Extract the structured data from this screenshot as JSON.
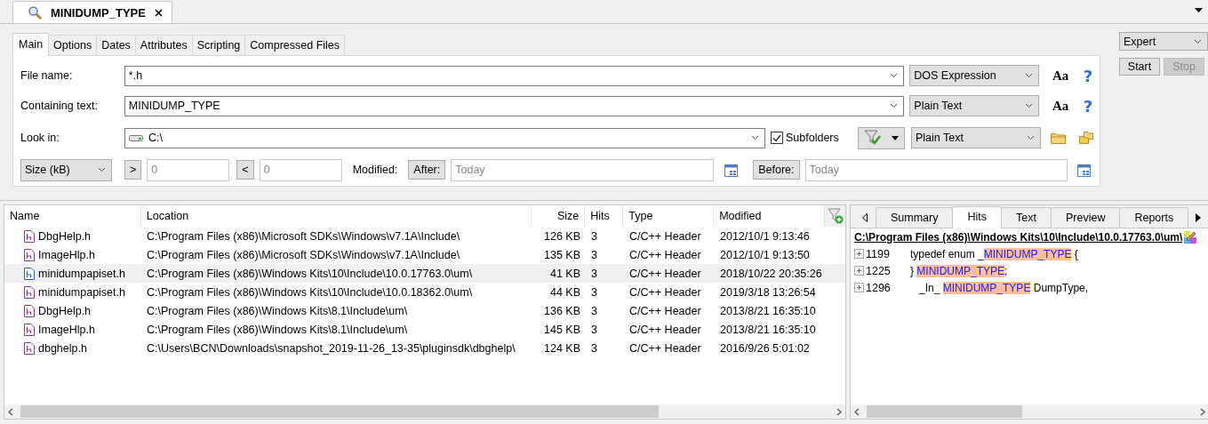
{
  "document_tab": {
    "title": "MINIDUMP_TYPE"
  },
  "search_tabs": [
    {
      "label": "Main",
      "selected": true
    },
    {
      "label": "Options",
      "selected": false
    },
    {
      "label": "Dates",
      "selected": false
    },
    {
      "label": "Attributes",
      "selected": false
    },
    {
      "label": "Scripting",
      "selected": false
    },
    {
      "label": "Compressed Files",
      "selected": false
    }
  ],
  "form": {
    "file_name": {
      "label": "File name:",
      "value": "*.h",
      "mode": "DOS Expression",
      "case_button": "Aa",
      "help_button": "?"
    },
    "containing_text": {
      "label": "Containing text:",
      "value": "MINIDUMP_TYPE",
      "mode": "Plain Text",
      "case_button": "Aa",
      "help_button": "?"
    },
    "look_in": {
      "label": "Look in:",
      "value": "C:\\",
      "subfolders_label": "Subfolders",
      "subfolders_checked": true,
      "mode": "Plain Text"
    },
    "size": {
      "unit": "Size (kB)",
      "greater_button": ">",
      "greater_value": "0",
      "less_button": "<",
      "less_value": "0"
    },
    "modified": {
      "label": "Modified:",
      "after_button": "After:",
      "after_placeholder": "Today",
      "before_button": "Before:",
      "before_placeholder": "Today"
    }
  },
  "search_mode": "Expert",
  "buttons": [
    {
      "label": "Start",
      "disabled": false
    },
    {
      "label": "Stop",
      "disabled": true
    }
  ],
  "results": {
    "columns": [
      "Name",
      "Location",
      "Size",
      "Hits",
      "Type",
      "Modified"
    ],
    "rows": [
      {
        "name": "DbgHelp.h",
        "location": "C:\\Program Files (x86)\\Microsoft SDKs\\Windows\\v7.1A\\Include\\",
        "size": "126 KB",
        "hits": "3",
        "type": "C/C++ Header",
        "modified": "2012/10/1 9:13:46",
        "selected": false
      },
      {
        "name": "ImageHlp.h",
        "location": "C:\\Program Files (x86)\\Microsoft SDKs\\Windows\\v7.1A\\Include\\",
        "size": "135 KB",
        "hits": "3",
        "type": "C/C++ Header",
        "modified": "2012/10/1 9:13:50",
        "selected": false
      },
      {
        "name": "minidumpapiset.h",
        "location": "C:\\Program Files (x86)\\Windows Kits\\10\\Include\\10.0.17763.0\\um\\",
        "size": "41 KB",
        "hits": "3",
        "type": "C/C++ Header",
        "modified": "2018/10/22 20:35:26",
        "selected": true
      },
      {
        "name": "minidumpapiset.h",
        "location": "C:\\Program Files (x86)\\Windows Kits\\10\\Include\\10.0.18362.0\\um\\",
        "size": "44 KB",
        "hits": "3",
        "type": "C/C++ Header",
        "modified": "2019/3/18 13:26:54",
        "selected": false
      },
      {
        "name": "DbgHelp.h",
        "location": "C:\\Program Files (x86)\\Windows Kits\\8.1\\Include\\um\\",
        "size": "136 KB",
        "hits": "3",
        "type": "C/C++ Header",
        "modified": "2013/8/21 16:35:10",
        "selected": false
      },
      {
        "name": "ImageHlp.h",
        "location": "C:\\Program Files (x86)\\Windows Kits\\8.1\\Include\\um\\",
        "size": "145 KB",
        "hits": "3",
        "type": "C/C++ Header",
        "modified": "2013/8/21 16:35:10",
        "selected": false
      },
      {
        "name": "dbghelp.h",
        "location": "C:\\Users\\BCN\\Downloads\\snapshot_2019-11-26_13-35\\pluginsdk\\dbghelp\\",
        "size": "124 KB",
        "hits": "3",
        "type": "C/C++ Header",
        "modified": "2016/9/26 5:01:02",
        "selected": false
      }
    ]
  },
  "preview": {
    "tabs": [
      {
        "label": "Summary",
        "selected": false
      },
      {
        "label": "Hits",
        "selected": true
      },
      {
        "label": "Text",
        "selected": false
      },
      {
        "label": "Preview",
        "selected": false
      },
      {
        "label": "Reports",
        "selected": false
      }
    ],
    "path": "C:\\Program Files (x86)\\Windows Kits\\10\\Include\\10.0.17763.0\\um\\",
    "hits": [
      {
        "line": "1199",
        "before": "typedef enum _",
        "match": "MINIDUMP_TYPE",
        "after": " {"
      },
      {
        "line": "1225",
        "before": "} ",
        "match": "MINIDUMP_TYPE",
        "after": ";"
      },
      {
        "line": "1296",
        "before": "   _In_ ",
        "match": "MINIDUMP_TYPE",
        "after": " DumpType,"
      }
    ]
  }
}
